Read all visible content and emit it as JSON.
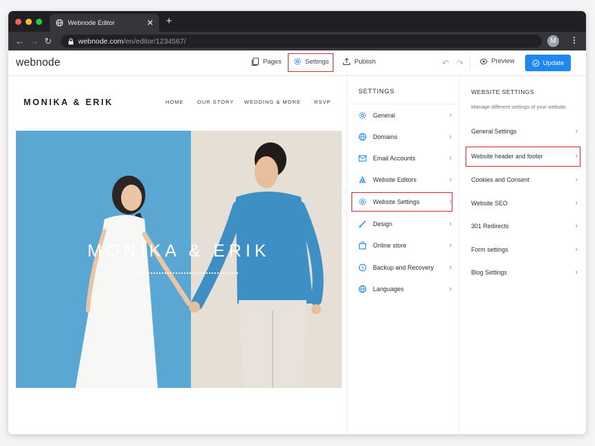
{
  "browser": {
    "tab_title": "Webnode Editor",
    "tab_close": "✕",
    "new_tab": "+",
    "url_host": "webnode.com",
    "url_path": "/en/editor/1234567/",
    "avatar_letter": "M"
  },
  "toolbar": {
    "logo": "webnode",
    "pages_label": "Pages",
    "settings_label": "Settings",
    "publish_label": "Publish",
    "preview_label": "Preview",
    "update_label": "Update"
  },
  "site": {
    "title": "MONIKA & ERIK",
    "nav": [
      "HOME",
      "OUR STORY",
      "WEDDING & MORE",
      "RSVP"
    ],
    "hero_title": "MONIKA & ERIK"
  },
  "settings_panel": {
    "heading": "SETTINGS",
    "items": [
      {
        "label": "General",
        "icon": "gear-icon"
      },
      {
        "label": "Domains",
        "icon": "globe-icon"
      },
      {
        "label": "Email Accounts",
        "icon": "envelope-icon"
      },
      {
        "label": "Website Editors",
        "icon": "editors-icon"
      },
      {
        "label": "Website Settings",
        "icon": "gear-icon"
      },
      {
        "label": "Design",
        "icon": "brush-icon"
      },
      {
        "label": "Online store",
        "icon": "store-icon"
      },
      {
        "label": "Backup and Recovery",
        "icon": "clock-icon"
      },
      {
        "label": "Languages",
        "icon": "globe-icon"
      }
    ]
  },
  "website_settings_panel": {
    "heading": "WEBSITE SETTINGS",
    "subtitle": "Manage different settings of your website.",
    "items": [
      "General Settings",
      "Website header and footer",
      "Cookies and Consent",
      "Website SEO",
      "301 Redirects",
      "Form settings",
      "Blog Settings"
    ]
  },
  "colors": {
    "accent": "#1e88f0",
    "highlight": "#e0262d",
    "hero_left": "#5aa7d3",
    "hero_right": "#e6dfd6"
  }
}
